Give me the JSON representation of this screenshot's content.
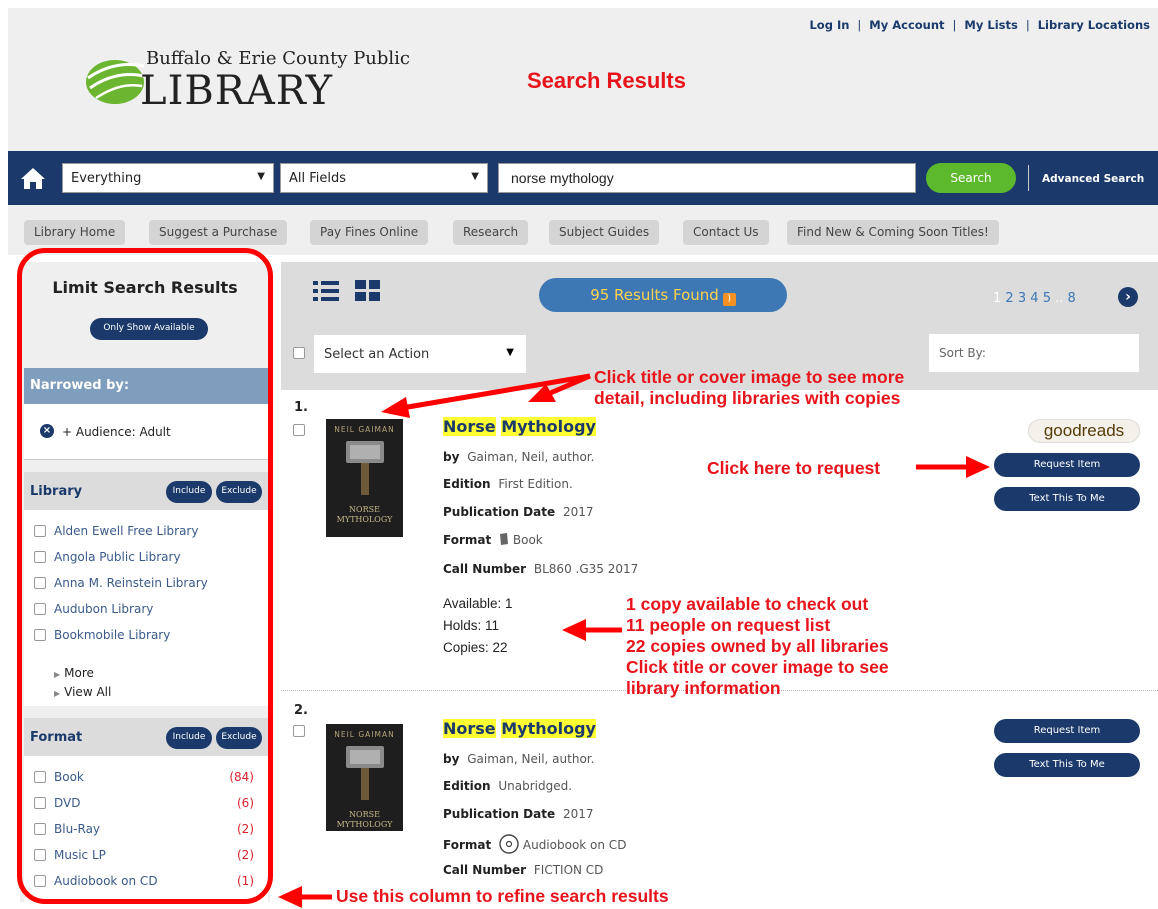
{
  "header": {
    "top_links": [
      "Log In",
      "My Account",
      "My Lists",
      "Library Locations"
    ],
    "logo_line1": "Buffalo & Erie County Public",
    "logo_line2": "LIBRARY",
    "page_heading": "Search Results"
  },
  "search": {
    "scope": "Everything",
    "field": "All Fields",
    "query": "norse mythology",
    "button_label": "Search",
    "advanced_label": "Advanced Search"
  },
  "nav": [
    "Library Home",
    "Suggest a Purchase",
    "Pay Fines Online",
    "Research",
    "Subject Guides",
    "Contact Us",
    "Find New & Coming Soon Titles!"
  ],
  "sidebar": {
    "title": "Limit Search Results",
    "only_available": "Only Show Available",
    "narrowed_label": "Narrowed by:",
    "narrowed_item": "+ Audience: Adult",
    "include_label": "Include",
    "exclude_label": "Exclude",
    "library": {
      "label": "Library",
      "items": [
        "Alden Ewell Free Library",
        "Angola Public Library",
        "Anna M. Reinstein Library",
        "Audubon Library",
        "Bookmobile Library"
      ],
      "more": "More",
      "view_all": "View All"
    },
    "format": {
      "label": "Format",
      "items": [
        {
          "label": "Book",
          "count": "(84)"
        },
        {
          "label": "DVD",
          "count": "(6)"
        },
        {
          "label": "Blu-Ray",
          "count": "(2)"
        },
        {
          "label": "Music LP",
          "count": "(2)"
        },
        {
          "label": "Audiobook on CD",
          "count": "(1)"
        }
      ]
    }
  },
  "results_bar": {
    "found": "95 Results Found",
    "pages": [
      "1",
      "2",
      "3",
      "4",
      "5",
      "..",
      "8"
    ],
    "action_placeholder": "Select an Action",
    "sort_label": "Sort By:"
  },
  "records": [
    {
      "num": "1.",
      "title_word1": "Norse",
      "title_word2": "Mythology",
      "by": "Gaiman, Neil, author.",
      "edition": "First Edition.",
      "pub_date": "2017",
      "format": "Book",
      "call_number": "BL860 .G35 2017",
      "available": "Available: 1",
      "holds": "Holds: 11",
      "copies": "Copies: 22",
      "cover_author": "NEIL GAIMAN",
      "cover_title_1": "NORSE",
      "cover_title_2": "MYTHOLOGY"
    },
    {
      "num": "2.",
      "title_word1": "Norse",
      "title_word2": "Mythology",
      "by": "Gaiman, Neil, author.",
      "edition": "Unabridged.",
      "pub_date": "2017",
      "format": "Audiobook on CD",
      "call_number": "FICTION CD",
      "cover_author": "NEIL GAIMAN",
      "cover_title_1": "NORSE",
      "cover_title_2": "MYTHOLOGY"
    }
  ],
  "labels": {
    "by": "by",
    "edition": "Edition",
    "pub_date": "Publication Date",
    "format": "Format",
    "call_number": "Call Number",
    "request": "Request Item",
    "text_me": "Text This To Me",
    "goodreads": "goodreads"
  },
  "annotations": {
    "title_cover": [
      "Click title or cover image to see more",
      "detail, including libraries with copies"
    ],
    "request": "Click here to request",
    "copies": [
      "1 copy available to check out",
      "11 people on request list",
      "22 copies owned by all libraries",
      "Click title or cover image to see",
      "library information"
    ],
    "column": "Use this column to refine search results"
  },
  "colors": {
    "navy": "#1b3a6b",
    "green": "#5cb82c",
    "annotation_red": "#e8141c",
    "highlight": "#ffff33"
  }
}
